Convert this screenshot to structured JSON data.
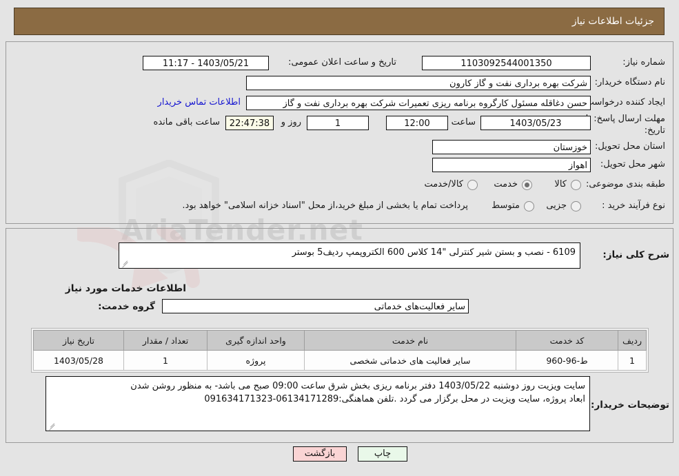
{
  "header": {
    "title": "جزئیات اطلاعات نیاز",
    "bar_color": "#8b6b43"
  },
  "watermark": {
    "text": "AriaTender.net"
  },
  "form": {
    "need_number": {
      "label": "شماره نیاز:",
      "value": "1103092544001350"
    },
    "announce_date": {
      "label": "تاریخ و ساعت اعلان عمومی:",
      "value": "1403/05/21 - 11:17"
    },
    "buyer_org": {
      "label": "نام دستگاه خریدار:",
      "value": "شرکت بهره برداری نفت و گاز کارون"
    },
    "requester": {
      "label": "ایجاد کننده درخواست:",
      "value": "حسن دغاقله مسئول کارگروه برنامه ریزی تعمیرات شرکت بهره برداری نفت و گاز",
      "contact_link": "اطلاعات تماس خریدار"
    },
    "deadline": {
      "label_line1": "مهلت ارسال پاسخ: تا",
      "label_line2": "تاریخ:",
      "date": "1403/05/23",
      "hour_label": "ساعت",
      "time": "12:00",
      "days": "1",
      "days_label": "روز و",
      "countdown": "22:47:38",
      "countdown_label": "ساعت باقی مانده"
    },
    "province": {
      "label": "استان محل تحویل:",
      "value": "خوزستان"
    },
    "city": {
      "label": "شهر محل تحویل:",
      "value": "اهواز"
    },
    "category": {
      "label": "طبقه بندی موضوعی:",
      "options": [
        "کالا",
        "خدمت",
        "کالا/خدمت"
      ],
      "selected": "خدمت"
    },
    "process_type": {
      "label": "نوع فرآیند خرید :",
      "options": [
        "جزیی",
        "متوسط"
      ],
      "selected": "",
      "note": "پرداخت تمام یا بخشی از مبلغ خرید،از محل \"اسناد خزانه اسلامی\" خواهد بود."
    }
  },
  "need_summary": {
    "label": "شرح کلی نیاز:",
    "value": "6109 - نصب و بستن شیر کنترلی \"14 کلاس 600 الکتروپمپ ردیف5 بوستر"
  },
  "services": {
    "heading": "اطلاعات خدمات مورد نیاز",
    "group_label": "گروه خدمت:",
    "group_value": "سایر فعالیت‌های خدماتی",
    "table": {
      "columns": [
        "ردیف",
        "کد خدمت",
        "نام خدمت",
        "واحد اندازه گیری",
        "تعداد / مقدار",
        "تاریخ نیاز"
      ],
      "rows": [
        [
          "1",
          "ط-96-960",
          "سایر فعالیت های خدماتی شخصی",
          "پروژه",
          "1",
          "1403/05/28"
        ]
      ]
    }
  },
  "buyer_notes": {
    "label": "توضیحات خریدار:",
    "line1": "سایت ویزیت روز دوشنبه 1403/05/22 دفتر برنامه ریزی بخش شرق ساعت 09:00 صبح می باشد- به منظور روشن شدن",
    "line2": "ابعاد پروژه، سایت ویزیت در محل برگزار می گردد .تلفن هماهنگی:06134171289-091634171323"
  },
  "buttons": {
    "print": "چاپ",
    "back": "بازگشت"
  }
}
